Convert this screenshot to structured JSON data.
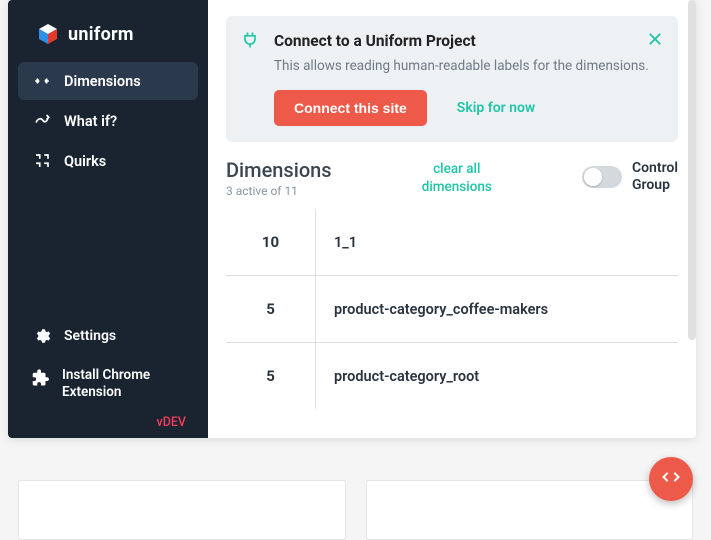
{
  "brand": {
    "name": "uniform"
  },
  "sidebar": {
    "items": [
      {
        "label": "Dimensions"
      },
      {
        "label": "What if?"
      },
      {
        "label": "Quirks"
      }
    ],
    "bottom": [
      {
        "label": "Settings"
      },
      {
        "label": "Install Chrome Extension"
      }
    ],
    "version": "vDEV"
  },
  "connect": {
    "title": "Connect to a Uniform Project",
    "desc": "This allows reading human-readable labels for the dimensions.",
    "cta": "Connect this site",
    "skip": "Skip for now"
  },
  "dimensions": {
    "title": "Dimensions",
    "subtitle": "3 active of 11",
    "clear_line1": "clear all",
    "clear_line2": "dimensions",
    "control_line1": "Control",
    "control_line2": "Group",
    "rows": [
      {
        "value": "10",
        "name": "1_1"
      },
      {
        "value": "5",
        "name": "product-category_coffee-makers"
      },
      {
        "value": "5",
        "name": "product-category_root"
      }
    ]
  }
}
